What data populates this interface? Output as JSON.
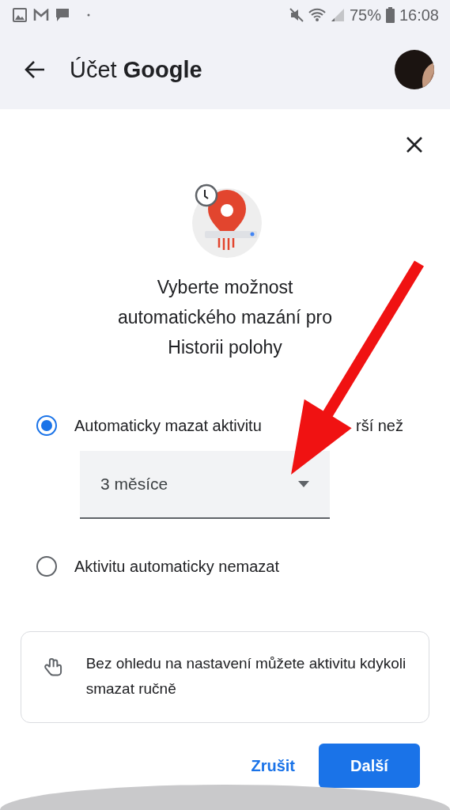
{
  "status_bar": {
    "time": "16:08",
    "battery": "75%"
  },
  "app_bar": {
    "title_prefix": "Účet",
    "title_brand": "Google"
  },
  "dialog": {
    "title": "Vyberte možnost automatického mazání pro Historii polohy",
    "options": [
      {
        "kind": "dropdown",
        "label": "Automaticky mazat aktivitu",
        "label_tail": "rší než",
        "selected": true,
        "dropdown": {
          "value": "3 měsíce"
        }
      },
      {
        "kind": "plain",
        "label": "Aktivitu automaticky nemazat",
        "selected": false
      }
    ],
    "info": "Bez ohledu na nastavení můžete aktivitu kdykoli smazat ručně",
    "buttons": [
      {
        "kind": "text",
        "label": "Zrušit"
      },
      {
        "kind": "filled",
        "label": "Další"
      }
    ]
  }
}
